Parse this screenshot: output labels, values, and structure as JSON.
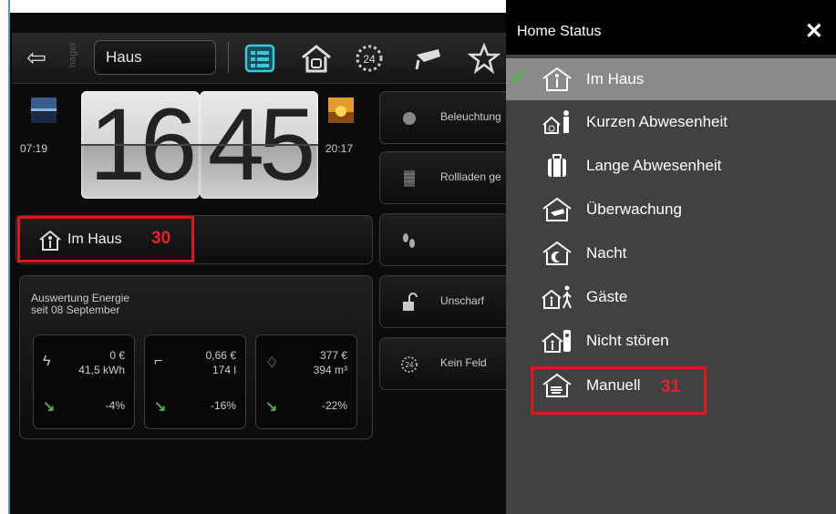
{
  "toolbar": {
    "back_icon": "back-arrow-icon",
    "brand": "hager",
    "location": "Haus",
    "icons": [
      "list-icon",
      "home-icon",
      "clock-24-icon",
      "camera-icon",
      "star-icon"
    ]
  },
  "clock": {
    "hours": "16",
    "minutes": "45",
    "sunrise": "07:19",
    "sunset": "20:17"
  },
  "status_tile": {
    "label": "Im Haus",
    "annotation": "30"
  },
  "energy": {
    "title": "Auswertung Energie",
    "subtitle": "seit 08 September",
    "cards": [
      {
        "icon": "lightning-icon",
        "cost": "0 €",
        "amount": "41,5 kWh",
        "change": "-4%"
      },
      {
        "icon": "water-tap-icon",
        "cost": "0,66 €",
        "amount": "174 l",
        "change": "-16%"
      },
      {
        "icon": "gas-flame-icon",
        "cost": "377 €",
        "amount": "394 m³",
        "change": "-22%"
      }
    ]
  },
  "right_tiles": [
    {
      "icon": "light-bulb-icon",
      "label": "Beleuchtung"
    },
    {
      "icon": "shutter-icon",
      "label": "Rollladen ge"
    },
    {
      "icon": "feet-icon",
      "label": ""
    },
    {
      "icon": "unlock-icon",
      "label": "Unscharf"
    },
    {
      "icon": "clock-24-icon",
      "label": "Kein Feld"
    }
  ],
  "panel": {
    "title": "Home Status",
    "items": [
      {
        "label": "Im Haus",
        "selected": true
      },
      {
        "label": "Kurzen Abwesenheit"
      },
      {
        "label": "Lange Abwesenheit"
      },
      {
        "label": "Überwachung"
      },
      {
        "label": "Nacht"
      },
      {
        "label": "Gäste"
      },
      {
        "label": "Nicht stören"
      },
      {
        "label": "Manuell",
        "annotation": "31"
      }
    ]
  },
  "colors": {
    "annotation_red": "#e3141c",
    "check_green": "#37c837",
    "trend_green": "#4caf50",
    "panel_bg": "#414141",
    "selected_bg": "#8a8a8a"
  }
}
